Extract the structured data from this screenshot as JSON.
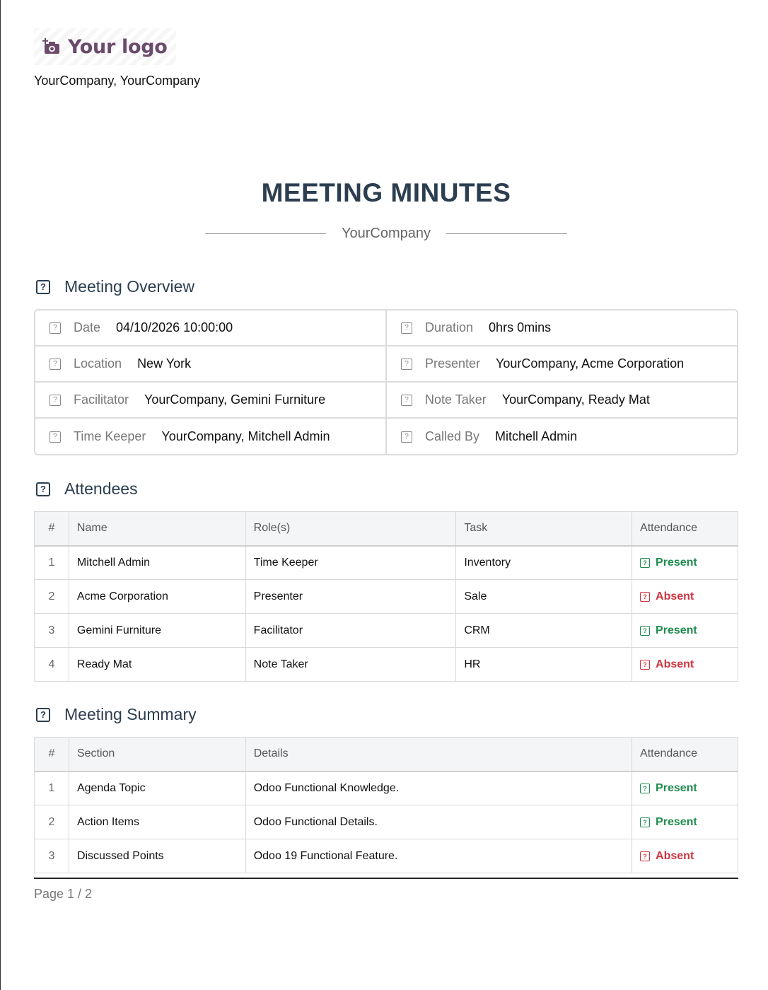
{
  "header": {
    "logo_text": "Your logo",
    "company_line": "YourCompany, YourCompany"
  },
  "title": "MEETING MINUTES",
  "subtitle": "YourCompany",
  "overview": {
    "heading": "Meeting Overview",
    "fields": [
      {
        "label": "Date",
        "value": "04/10/2026 10:00:00"
      },
      {
        "label": "Duration",
        "value": "0hrs 0mins"
      },
      {
        "label": "Location",
        "value": "New York"
      },
      {
        "label": "Presenter",
        "value": "YourCompany, Acme Corporation"
      },
      {
        "label": "Facilitator",
        "value": "YourCompany, Gemini Furniture"
      },
      {
        "label": "Note Taker",
        "value": "YourCompany, Ready Mat"
      },
      {
        "label": "Time Keeper",
        "value": "YourCompany, Mitchell Admin"
      },
      {
        "label": "Called By",
        "value": "Mitchell Admin"
      }
    ]
  },
  "attendees": {
    "heading": "Attendees",
    "columns": [
      "#",
      "Name",
      "Role(s)",
      "Task",
      "Attendance"
    ],
    "rows": [
      {
        "num": "1",
        "name": "Mitchell Admin",
        "role": "Time Keeper",
        "task": "Inventory",
        "attendance": "Present"
      },
      {
        "num": "2",
        "name": "Acme Corporation",
        "role": "Presenter",
        "task": "Sale",
        "attendance": "Absent"
      },
      {
        "num": "3",
        "name": "Gemini Furniture",
        "role": "Facilitator",
        "task": "CRM",
        "attendance": "Present"
      },
      {
        "num": "4",
        "name": "Ready Mat",
        "role": "Note Taker",
        "task": "HR",
        "attendance": "Absent"
      }
    ]
  },
  "summary": {
    "heading": "Meeting Summary",
    "columns": [
      "#",
      "Section",
      "Details",
      "Attendance"
    ],
    "rows": [
      {
        "num": "1",
        "section": "Agenda Topic",
        "details": "Odoo Functional Knowledge.",
        "attendance": "Present"
      },
      {
        "num": "2",
        "section": "Action Items",
        "details": "Odoo Functional Details.",
        "attendance": "Present"
      },
      {
        "num": "3",
        "section": "Discussed Points",
        "details": "Odoo 19 Functional Feature.",
        "attendance": "Absent"
      }
    ]
  },
  "status_colors": {
    "Present": "#1e8c4e",
    "Absent": "#d0343f"
  },
  "icons": {
    "logo": "camera-plus-icon",
    "section": "question-box-icon",
    "field": "question-box-icon",
    "status": "question-box-icon"
  },
  "footer": {
    "page": "Page 1 / 2"
  }
}
